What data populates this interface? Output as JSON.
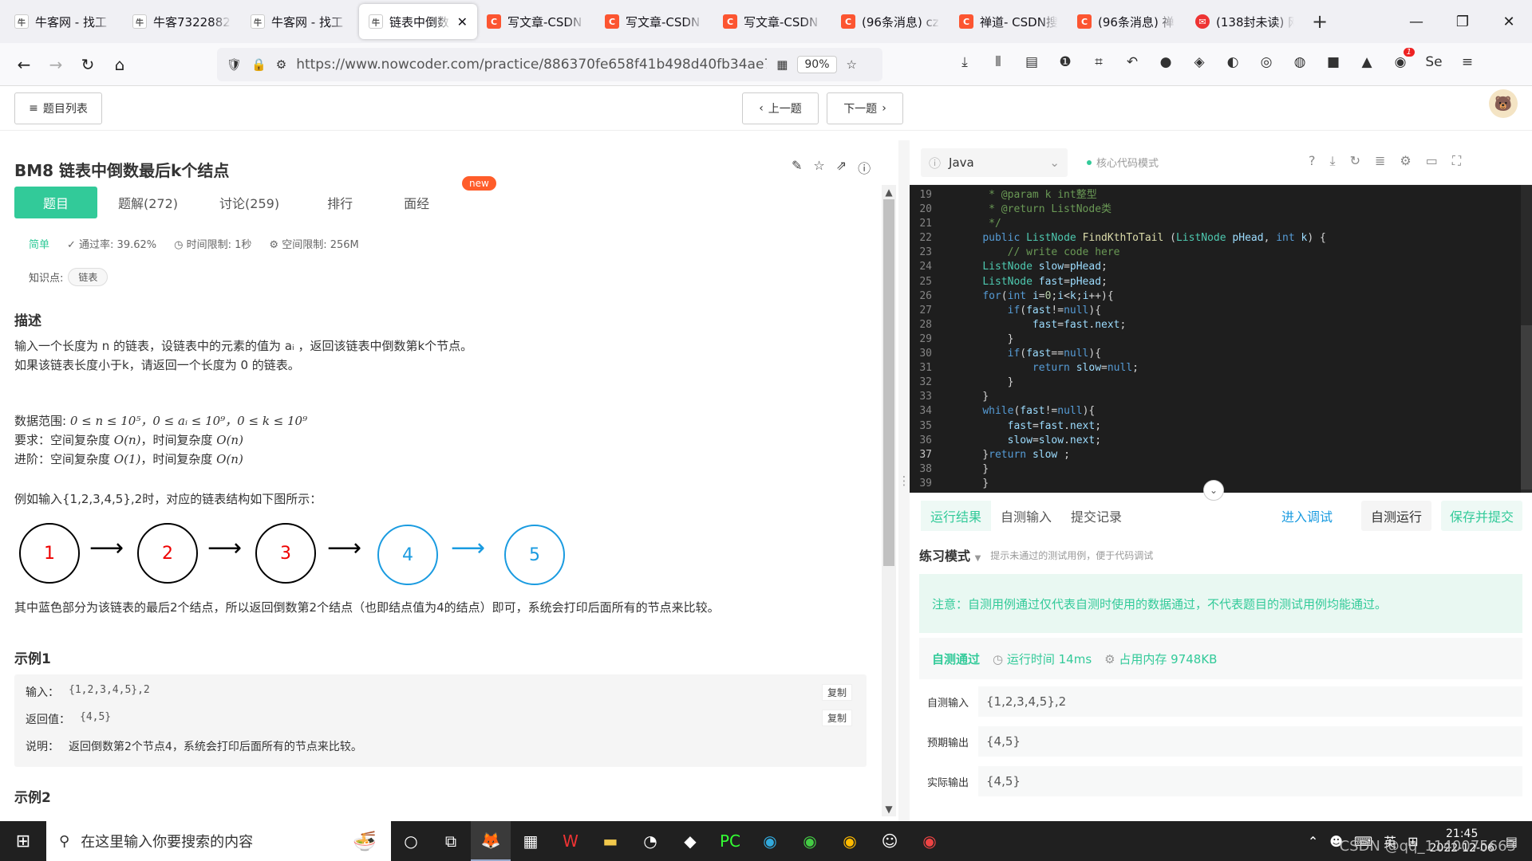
{
  "browser": {
    "tabs": [
      {
        "title": "牛客网 - 找工",
        "icon": "nowcoder-icon"
      },
      {
        "title": "牛客7322882",
        "icon": "nowcoder-icon"
      },
      {
        "title": "牛客网 - 找工",
        "icon": "nowcoder-icon"
      },
      {
        "title": "链表中倒数",
        "icon": "nowcoder-icon",
        "active": true
      },
      {
        "title": "写文章-CSDN",
        "icon": "csdn-icon"
      },
      {
        "title": "写文章-CSDN",
        "icon": "csdn-icon"
      },
      {
        "title": "写文章-CSDN",
        "icon": "csdn-icon"
      },
      {
        "title": "(96条消息) cz",
        "icon": "csdn-icon"
      },
      {
        "title": "禅道- CSDN搜",
        "icon": "csdn-icon"
      },
      {
        "title": "(96条消息) 禅",
        "icon": "csdn-icon"
      },
      {
        "title": "(138封未读) 网",
        "icon": "mail-icon"
      }
    ],
    "url": "https://www.nowcoder.com/practice/886370fe658f41b498d40fb34ae7",
    "zoom": "90%",
    "badge_count": "1"
  },
  "subheader": {
    "problem_list": "题目列表",
    "prev": "上一题",
    "next": "下一题"
  },
  "problem": {
    "title": "BM8  链表中倒数最后k个结点",
    "tabs": [
      "题目",
      "题解(272)",
      "讨论(259)",
      "排行",
      "面经"
    ],
    "new_badge": "new",
    "difficulty": "简单",
    "pass_rate": "通过率: 39.62%",
    "time_limit": "时间限制: 1秒",
    "space_limit": "空间限制: 256M",
    "knowledge_label": "知识点:",
    "knowledge_tag": "链表",
    "desc_heading": "描述",
    "desc_line1": "输入一个长度为 n 的链表，设链表中的元素的值为 aᵢ ，返回该链表中倒数第k个节点。",
    "desc_line2": "如果该链表长度小于k，请返回一个长度为 0 的链表。",
    "range_label": "数据范围:",
    "range_math": "0 ≤ n ≤ 10⁵，0 ≤ aᵢ ≤ 10⁹，0 ≤ k ≤ 10⁹",
    "req_label": "要求：空间复杂度",
    "req_space": "O(n)",
    "req_mid": "，时间复杂度",
    "req_time": "O(n)",
    "adv_label": "进阶：空间复杂度",
    "adv_space": "O(1)",
    "adv_mid": "，时间复杂度",
    "adv_time": "O(n)",
    "example_intro": "例如输入{1,2,3,4,5},2时，对应的链表结构如下图所示：",
    "nodes": [
      "1",
      "2",
      "3",
      "4",
      "5"
    ],
    "explain": "其中蓝色部分为该链表的最后2个结点，所以返回倒数第2个结点（也即结点值为4的结点）即可，系统会打印后面所有的节点来比较。",
    "example1_heading": "示例1",
    "example1": {
      "input_label": "输入：",
      "input": "{1,2,3,4,5},2",
      "output_label": "返回值：",
      "output": "{4,5}",
      "note_label": "说明：",
      "note": "返回倒数第2个节点4，系统会打印后面所有的节点来比较。",
      "copy": "复制"
    },
    "example2_heading": "示例2"
  },
  "editor": {
    "language": "Java",
    "mode": "核心代码模式",
    "lines": [
      {
        "n": "19",
        "html": "<span class='c'> * @param k int整型</span>"
      },
      {
        "n": "20",
        "html": "<span class='c'> * @return ListNode类</span>"
      },
      {
        "n": "21",
        "html": "<span class='c'> */</span>"
      },
      {
        "n": "22",
        "html": "<span class='k'>public</span> <span class='ty'>ListNode</span> <span class='f'>FindKthToTail</span> (<span class='ty'>ListNode</span> <span class='v'>pHead</span>, <span class='k'>int</span> <span class='v'>k</span>) {"
      },
      {
        "n": "23",
        "html": "    <span class='c'>// write code here</span>"
      },
      {
        "n": "24",
        "html": "<span class='ty'>ListNode</span> <span class='v'>slow</span>=<span class='v'>pHead</span>;"
      },
      {
        "n": "25",
        "html": "<span class='ty'>ListNode</span> <span class='v'>fast</span>=<span class='v'>pHead</span>;"
      },
      {
        "n": "26",
        "html": "<span class='k'>for</span>(<span class='k'>int</span> <span class='v'>i</span>=<span class='n'>0</span>;<span class='v'>i</span>&lt;<span class='v'>k</span>;<span class='v'>i</span>++){"
      },
      {
        "n": "27",
        "html": "    <span class='k'>if</span>(<span class='v'>fast</span>!=<span class='k'>null</span>){"
      },
      {
        "n": "28",
        "html": "        <span class='v'>fast</span>=<span class='v'>fast</span>.<span class='v'>next</span>;"
      },
      {
        "n": "29",
        "html": "    }"
      },
      {
        "n": "30",
        "html": "    <span class='k'>if</span>(<span class='v'>fast</span>==<span class='k'>null</span>){"
      },
      {
        "n": "31",
        "html": "        <span class='k'>return</span> <span class='v'>slow</span>=<span class='k'>null</span>;"
      },
      {
        "n": "32",
        "html": "    }"
      },
      {
        "n": "33",
        "html": "}"
      },
      {
        "n": "34",
        "html": "<span class='k'>while</span>(<span class='v'>fast</span>!=<span class='k'>null</span>){"
      },
      {
        "n": "35",
        "html": "    <span class='v'>fast</span>=<span class='v'>fast</span>.<span class='v'>next</span>;"
      },
      {
        "n": "36",
        "html": "    <span class='v'>slow</span>=<span class='v'>slow</span>.<span class='v'>next</span>;"
      },
      {
        "n": "37",
        "html": "}<span class='k'>return</span> <span class='v'>slow</span> ;"
      },
      {
        "n": "38",
        "html": "}"
      },
      {
        "n": "39",
        "html": "}"
      }
    ]
  },
  "results": {
    "tabs": [
      "运行结果",
      "自测输入",
      "提交记录"
    ],
    "debug": "进入调试",
    "self_run": "自测运行",
    "save_submit": "保存并提交",
    "practice_mode": "练习模式",
    "practice_hint": "提示未通过的测试用例，便于代码调试",
    "notice": "注意：自测用例通过仅代表自测时使用的数据通过，不代表题目的测试用例均能通过。",
    "status": "自测通过",
    "runtime": "运行时间 14ms",
    "memory": "占用内存 9748KB",
    "self_input_label": "自测输入",
    "self_input": "{1,2,3,4,5},2",
    "expected_label": "预期输出",
    "expected": "{4,5}",
    "actual_label": "实际输出",
    "actual": "{4,5}"
  },
  "taskbar": {
    "search_placeholder": "在这里输入你要搜索的内容",
    "ime": "英",
    "time": "21:45",
    "date": "2022-12-06",
    "watermark": "CSDN @qq_1140075663"
  },
  "colors": {
    "accent": "#32ca99",
    "link_blue": "#1a9be0",
    "code_bg": "#1e1e1e"
  }
}
